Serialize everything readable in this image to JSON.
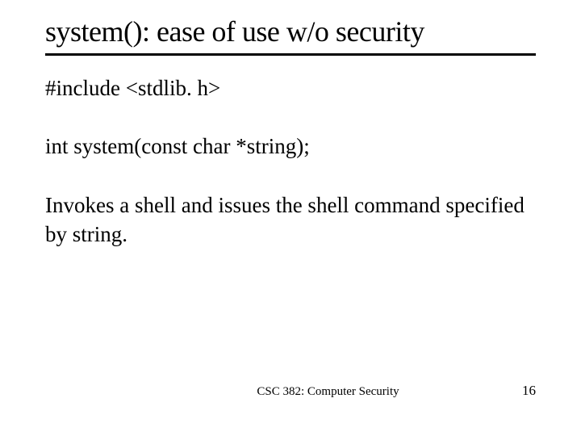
{
  "title": "system(): ease of use w/o security",
  "body": {
    "line1": "#include <stdlib. h>",
    "line2": "int system(const char *string);",
    "line3": "Invokes a shell and issues the shell command specified by string."
  },
  "footer": {
    "course": "CSC 382: Computer Security",
    "page": "16"
  }
}
